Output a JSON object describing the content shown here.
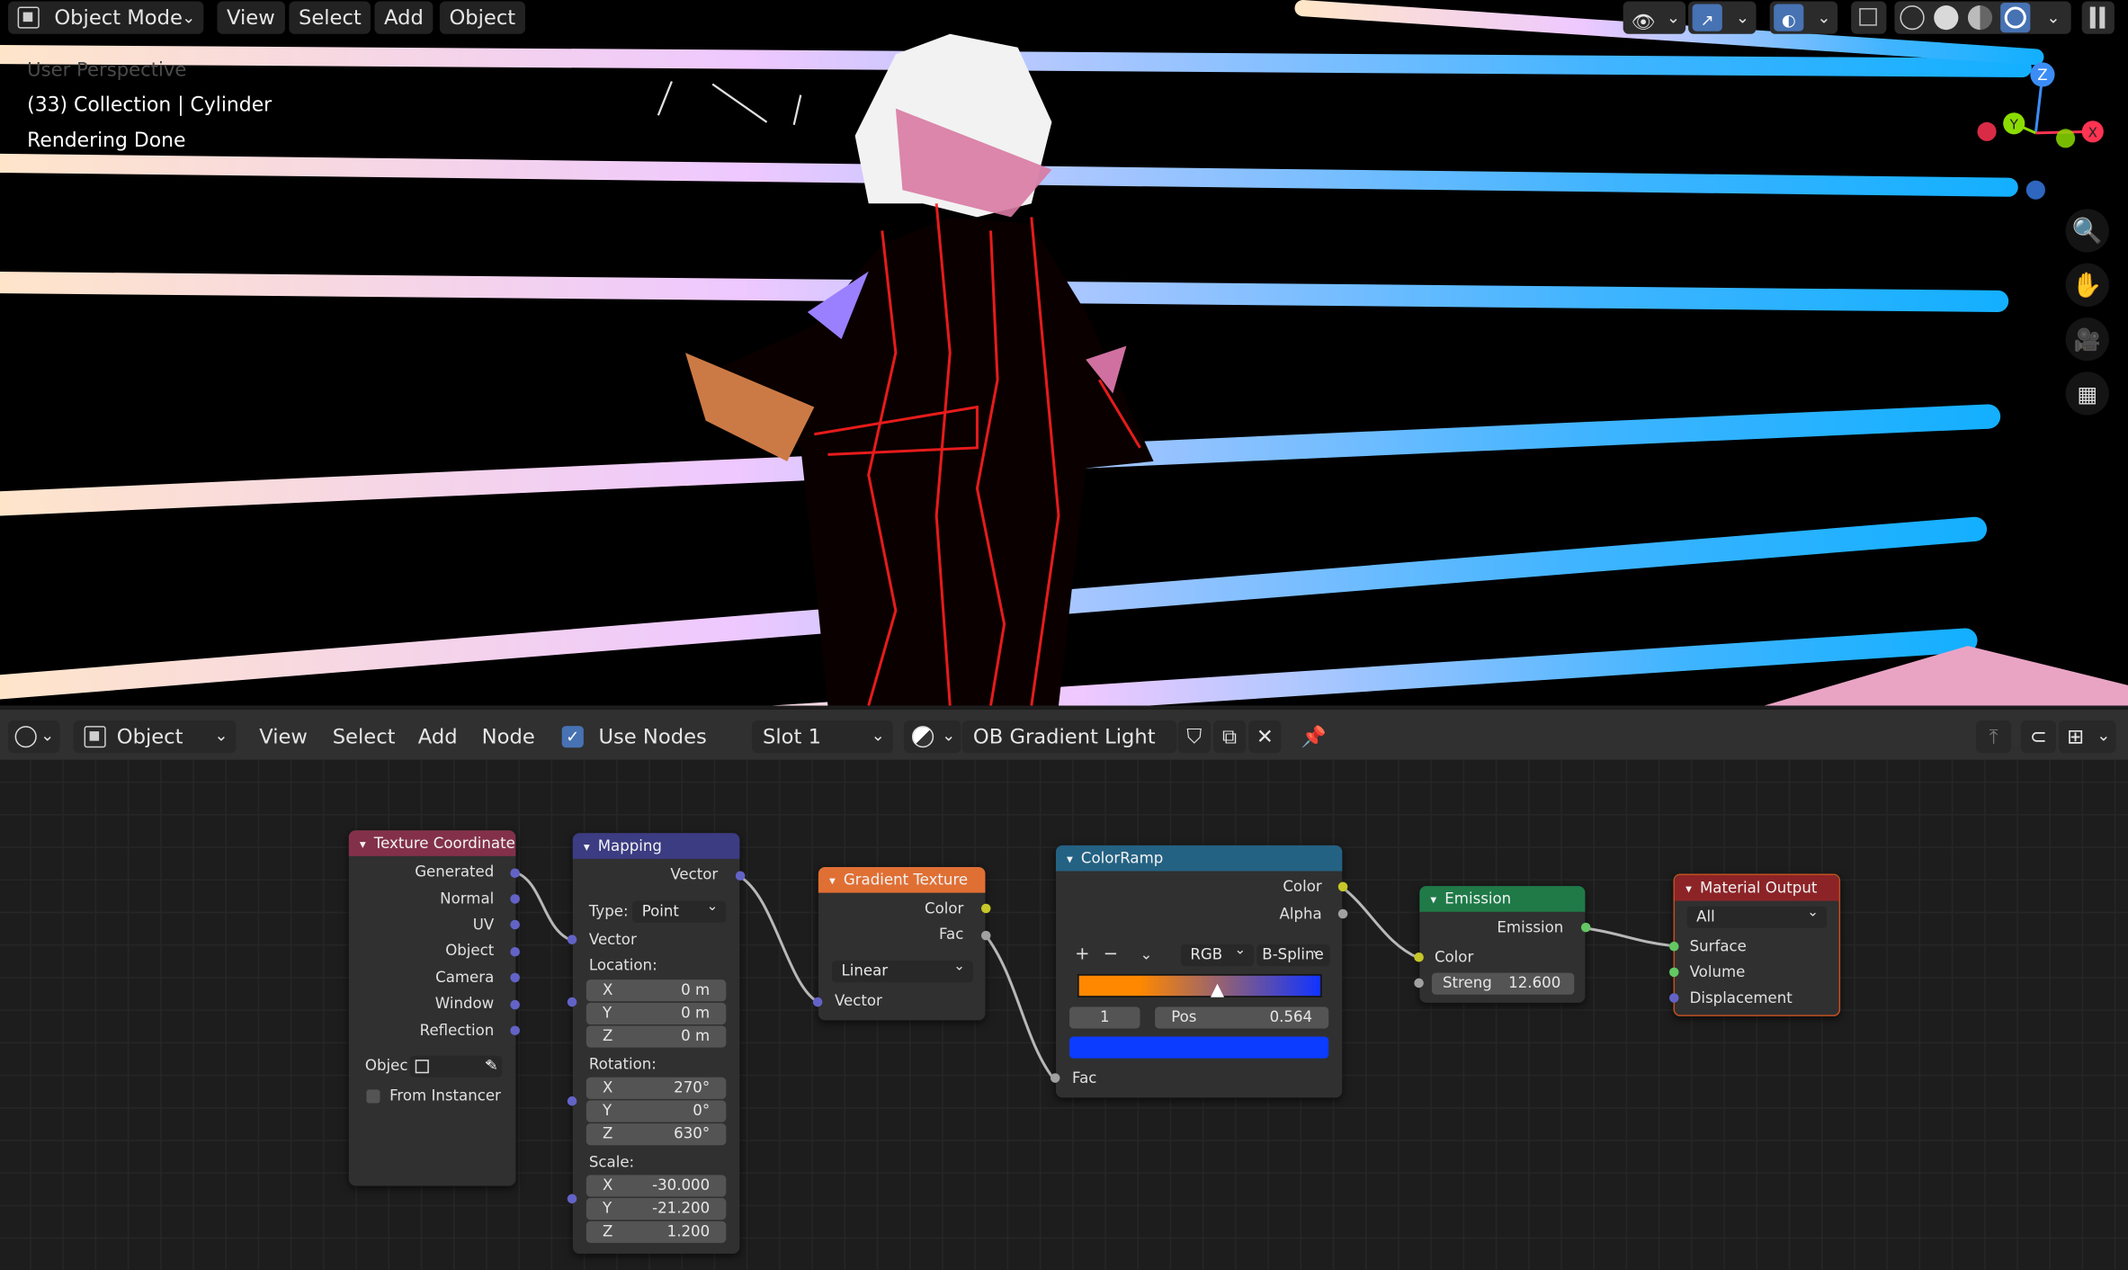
{
  "viewport": {
    "header": {
      "mode": "Object Mode",
      "menus": [
        "View",
        "Select",
        "Add",
        "Object"
      ]
    },
    "overlay": {
      "perspective": "User Perspective",
      "collection": "(33) Collection | Cylinder",
      "status": "Rendering Done"
    },
    "gizmo": {
      "z": "Z",
      "y": "Y",
      "x": "X"
    }
  },
  "node_editor_header": {
    "editor": "Object",
    "menus": [
      "View",
      "Select",
      "Add",
      "Node"
    ],
    "use_nodes_label": "Use Nodes",
    "use_nodes_checked": true,
    "slot": "Slot 1",
    "material": "OB Gradient Light"
  },
  "nodes": {
    "texture_coordinate": {
      "title": "Texture Coordinate",
      "outputs": [
        "Generated",
        "Normal",
        "UV",
        "Object",
        "Camera",
        "Window",
        "Reflection"
      ],
      "object_label": "Objec",
      "from_instancer": "From Instancer"
    },
    "mapping": {
      "title": "Mapping",
      "output": "Vector",
      "type_label": "Type:",
      "type_value": "Point",
      "vector_input": "Vector",
      "location_label": "Location:",
      "location": [
        {
          "axis": "X",
          "value": "0 m"
        },
        {
          "axis": "Y",
          "value": "0 m"
        },
        {
          "axis": "Z",
          "value": "0 m"
        }
      ],
      "rotation_label": "Rotation:",
      "rotation": [
        {
          "axis": "X",
          "value": "270°"
        },
        {
          "axis": "Y",
          "value": "0°"
        },
        {
          "axis": "Z",
          "value": "630°"
        }
      ],
      "scale_label": "Scale:",
      "scale": [
        {
          "axis": "X",
          "value": "-30.000"
        },
        {
          "axis": "Y",
          "value": "-21.200"
        },
        {
          "axis": "Z",
          "value": "1.200"
        }
      ]
    },
    "gradient_texture": {
      "title": "Gradient Texture",
      "outputs": [
        "Color",
        "Fac"
      ],
      "type_value": "Linear",
      "input": "Vector"
    },
    "color_ramp": {
      "title": "ColorRamp",
      "outputs": [
        "Color",
        "Alpha"
      ],
      "add": "+",
      "remove": "−",
      "color_mode": "RGB",
      "interpolation": "B-Spline",
      "active_index": "1",
      "pos_label": "Pos",
      "pos_value": "0.564",
      "input": "Fac",
      "stop_fraction": 0.564,
      "ramp_colors": [
        "#ff8800",
        "#1133ff"
      ],
      "active_color": "#0b3cff"
    },
    "emission": {
      "title": "Emission",
      "output": "Emission",
      "color_input": "Color",
      "strength_label": "Streng",
      "strength_value": "12.600"
    },
    "material_output": {
      "title": "Material Output",
      "target": "All",
      "inputs": [
        "Surface",
        "Volume",
        "Displacement"
      ]
    }
  },
  "colors": {
    "header_input": "#83314a",
    "header_vector": "#3c3c83",
    "header_texture": "#e06f34",
    "header_converter": "#246283",
    "header_shader": "#1f7a48",
    "header_output": "#8c2427",
    "beam_cyan": "#19b2ff",
    "beam_peach": "#ffe6c8"
  },
  "icons": [
    "object-mode-icon",
    "eye-icon",
    "gizmo-icon",
    "overlay-icon",
    "xray-icon",
    "wireframe-icon",
    "solid-icon",
    "material-preview-icon",
    "rendered-icon",
    "zoom-icon",
    "hand-icon",
    "camera-icon",
    "grid-icon",
    "editor-type-icon",
    "material-sphere-icon",
    "shield-icon",
    "duplicate-icon",
    "close-icon",
    "pin-icon",
    "parent-icon",
    "snap-icon"
  ]
}
